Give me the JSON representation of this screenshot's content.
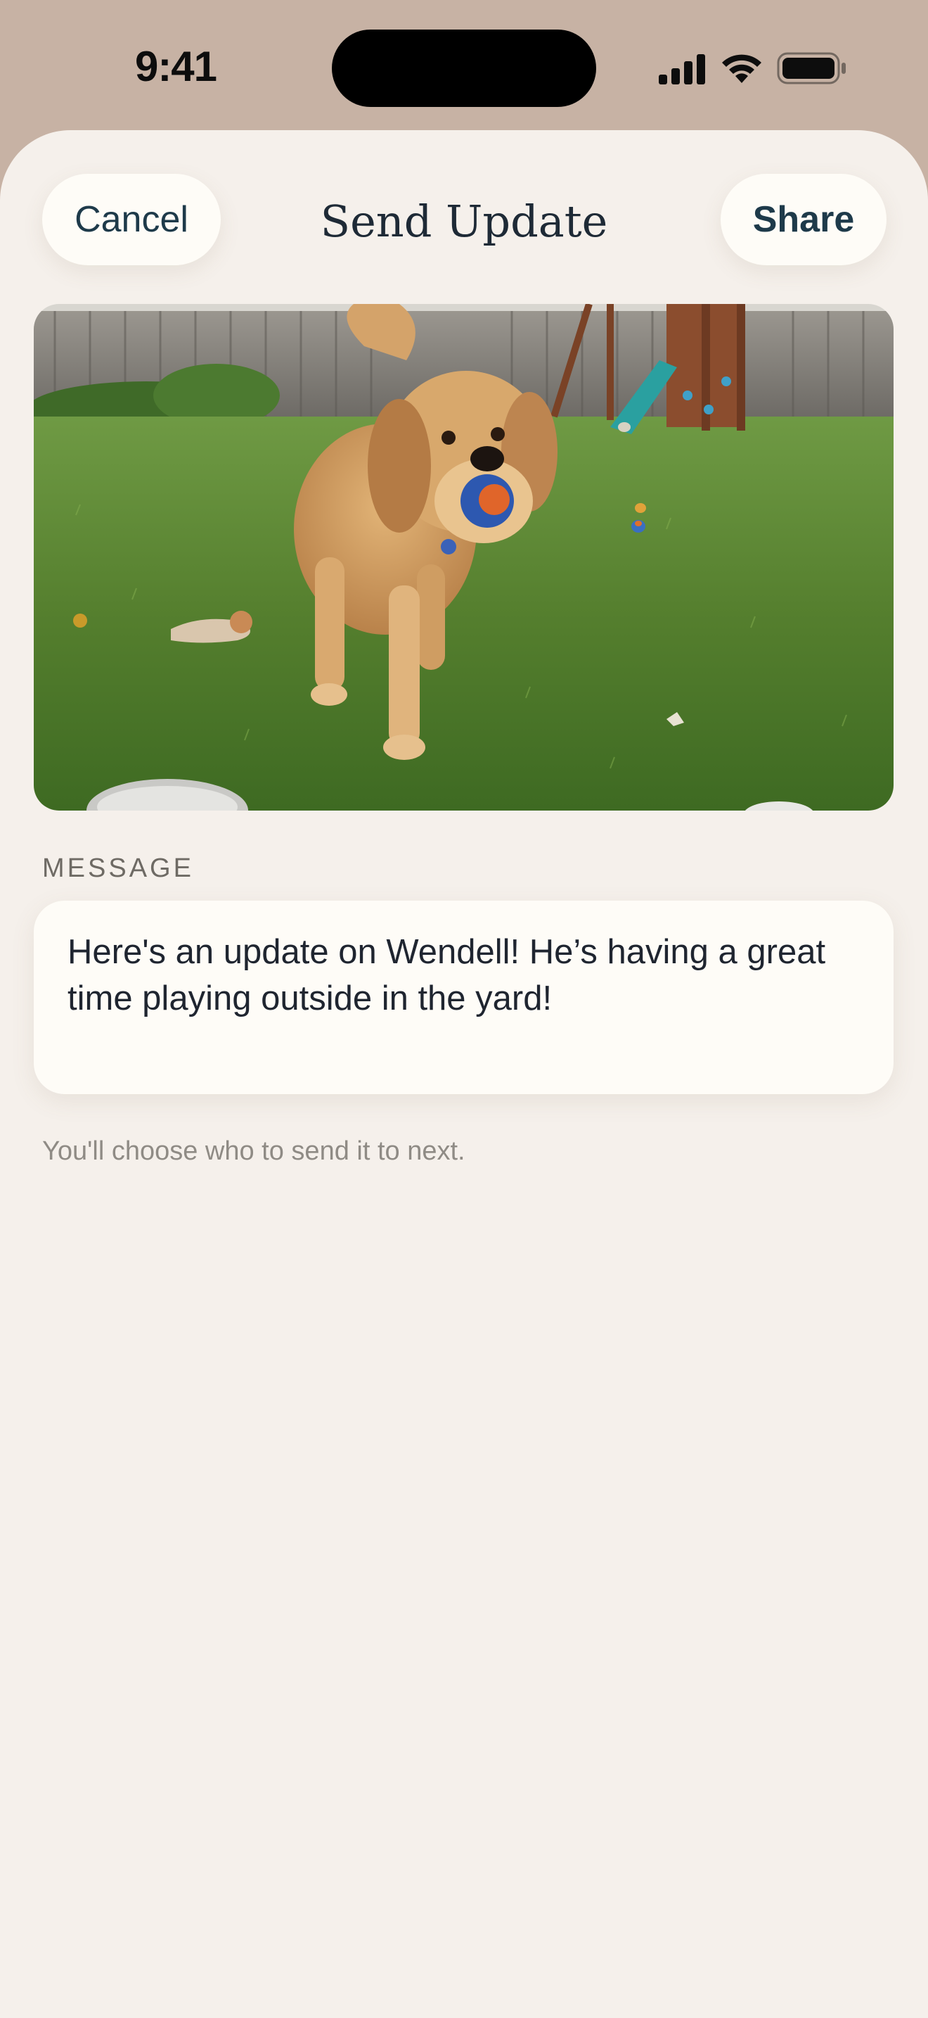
{
  "status_bar": {
    "time": "9:41"
  },
  "header": {
    "cancel_label": "Cancel",
    "title": "Send Update",
    "share_label": "Share"
  },
  "photo": {
    "subject": "golden-retriever-with-ball-in-yard"
  },
  "message": {
    "section_label": "MESSAGE",
    "text": "Here's an update on Wendell! He’s having a great time playing outside in the yard!"
  },
  "hint": "You'll choose who to send it to next.",
  "colors": {
    "backdrop": "#c7b2a4",
    "sheet_background": "#f5f0eb",
    "button_background": "#fefcf7",
    "button_text": "#1e3a4a",
    "title_text": "#1e2a36",
    "label_text": "#6e6a64",
    "hint_text": "#8f8b85"
  }
}
